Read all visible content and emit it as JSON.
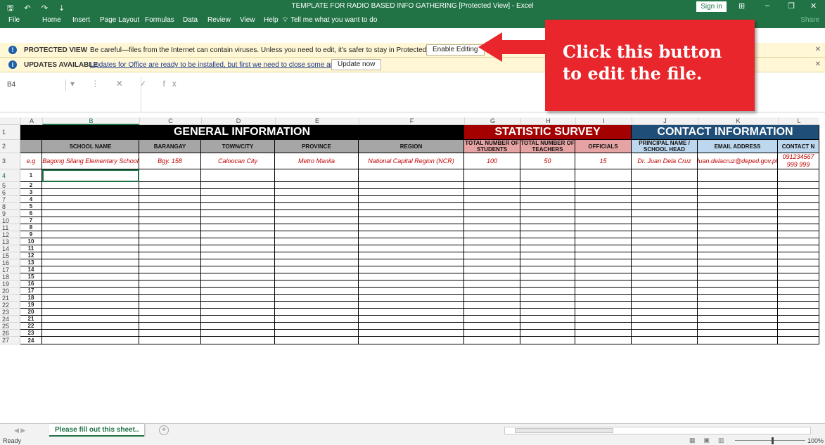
{
  "window": {
    "title": "TEMPLATE FOR RADIO BASED INFO GATHERING  [Protected View]  -  Excel",
    "quick_access": "🖫 ↶ ↷ ⇣",
    "sign_in": "Sign in",
    "minimize": "–",
    "restore": "❐",
    "close": "✕"
  },
  "ribbon": {
    "tabs": [
      "File",
      "Home",
      "Insert",
      "Page Layout",
      "Formulas",
      "Data",
      "Review",
      "View",
      "Help",
      "Tell me what you want to do"
    ],
    "share": "Share"
  },
  "protected_bar": {
    "label": "PROTECTED VIEW",
    "message": "Be careful—files from the Internet can contain viruses. Unless you need to edit, it's safer to stay in Protected View.",
    "button": "Enable Editing"
  },
  "updates_bar": {
    "label": "UPDATES AVAILABLE",
    "message": "Updates for Office are ready to be installed, but first we need to close some apps.",
    "button": "Update now"
  },
  "name_box": "B4",
  "formula_icons": "▾ ⋮ ✕ ✓ fx",
  "columns": [
    "A",
    "B",
    "C",
    "D",
    "E",
    "F",
    "G",
    "H",
    "I",
    "J",
    "K",
    "L"
  ],
  "sections": {
    "general": "GENERAL INFORMATION",
    "statistic": "STATISTIC SURVEY",
    "contact": "CONTACT INFORMATION"
  },
  "headers": {
    "school": "SCHOOL NAME",
    "barangay": "BARANGAY",
    "town": "TOWN/CITY",
    "province": "PROVINCE",
    "region": "REGION",
    "students": "TOTAL NUMBER OF STUDENTS",
    "teachers": "TOTAL NUMBER OF TEACHERS",
    "officials": "OFFICIALS",
    "principal": "PRINCIPAL NAME / SCHOOL HEAD",
    "email": "EMAIL ADDRESS",
    "contact": "CONTACT N"
  },
  "example_row": {
    "label": "e.g",
    "school": "Bagong Silang Elementary School",
    "barangay": "Bgy. 158",
    "town": "Caloocan City",
    "province": "Metro Manila",
    "region": "National Capital Region (NCR)",
    "students": "100",
    "teachers": "50",
    "officials": "15",
    "principal": "Dr. Juan Dela Cruz",
    "email": "Juan.delacruz@deped.gov.ph",
    "contact": "091234567 999 999"
  },
  "row_numbers": [
    "1",
    "2",
    "3",
    "4",
    "5",
    "6",
    "7",
    "8",
    "9",
    "10",
    "11",
    "12",
    "13",
    "14",
    "15",
    "16",
    "17",
    "18",
    "19",
    "20",
    "21",
    "22",
    "23",
    "24",
    "25",
    "26",
    "27"
  ],
  "entry_numbers": [
    "1",
    "2",
    "3",
    "4",
    "5",
    "6",
    "7",
    "8",
    "9",
    "10",
    "11",
    "12",
    "13",
    "14",
    "15",
    "16",
    "17",
    "18",
    "19",
    "20",
    "21",
    "22",
    "23",
    "24"
  ],
  "sheet_tab": "Please fill out this sheet..",
  "status": {
    "ready": "Ready",
    "zoom": "100%"
  },
  "callout": {
    "line1": "Click this button",
    "line2": "to edit the file."
  },
  "colors": {
    "excel_green": "#217346",
    "general_header_bg": "#000000",
    "statistic_header_bg": "#a50000",
    "contact_header_bg": "#1f4e79",
    "column_header_bg": "#a6a6a6",
    "statistic_column_bg": "#e6a3a3",
    "contact_column_bg": "#bdd7ee",
    "callout_bg": "#e8262c",
    "example_text": "#c00000"
  }
}
